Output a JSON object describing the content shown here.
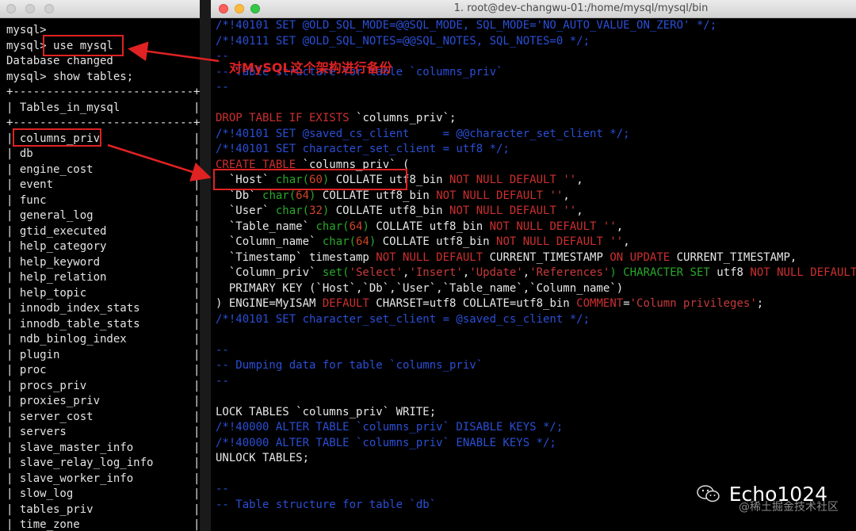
{
  "left_window": {
    "title": "",
    "lines": [
      "mysql>",
      "mysql> use mysql",
      "Database changed",
      "mysql> show tables;",
      "+---------------------------+",
      "| Tables_in_mysql           |",
      "+---------------------------+",
      "| columns_priv              |",
      "| db                        |",
      "| engine_cost               |",
      "| event                     |",
      "| func                      |",
      "| general_log               |",
      "| gtid_executed             |",
      "| help_category             |",
      "| help_keyword              |",
      "| help_relation             |",
      "| help_topic                |",
      "| innodb_index_stats        |",
      "| innodb_table_stats        |",
      "| ndb_binlog_index          |",
      "| plugin                    |",
      "| proc                      |",
      "| procs_priv                |",
      "| proxies_priv              |",
      "| server_cost               |",
      "| servers                   |",
      "| slave_master_info         |",
      "| slave_relay_log_info      |",
      "| slave_worker_info         |",
      "| slow_log                  |",
      "| tables_priv               |",
      "| time_zone                 |"
    ]
  },
  "right_window": {
    "title": "1. root@dev-changwu-01:/home/mysql/mysql/bin",
    "lines": [
      [
        [
          "c",
          "/*!40101 SET @OLD_SQL_MODE=@@SQL_MODE, SQL_MODE='NO_AUTO_VALUE_ON_ZERO' */;"
        ]
      ],
      [
        [
          "c",
          "/*!40111 SET @OLD_SQL_NOTES=@@SQL_NOTES, SQL_NOTES=0 */;"
        ]
      ],
      [
        [
          "c",
          "--"
        ]
      ],
      [
        [
          "c",
          "-- Table structure for table `columns_priv`"
        ]
      ],
      [
        [
          "c",
          "--"
        ]
      ],
      [
        [
          "w",
          ""
        ]
      ],
      [
        [
          "k",
          "DROP TABLE IF EXISTS "
        ],
        [
          "w",
          "`columns_priv`;"
        ]
      ],
      [
        [
          "c",
          "/*!40101 SET @saved_cs_client     = @@character_set_client */;"
        ]
      ],
      [
        [
          "c",
          "/*!40101 SET character_set_client = utf8 */;"
        ]
      ],
      [
        [
          "k",
          "CREATE TABLE "
        ],
        [
          "w",
          "`columns_priv` ("
        ]
      ],
      [
        [
          "w",
          "  `Host` "
        ],
        [
          "g",
          "char("
        ],
        [
          "n",
          "60"
        ],
        [
          "g",
          ")"
        ],
        [
          "w",
          " COLLATE utf8_bin "
        ],
        [
          "k",
          "NOT NULL DEFAULT "
        ],
        [
          "s",
          "''"
        ],
        [
          "w",
          ","
        ]
      ],
      [
        [
          "w",
          "  `Db` "
        ],
        [
          "g",
          "char("
        ],
        [
          "n",
          "64"
        ],
        [
          "g",
          ")"
        ],
        [
          "w",
          " COLLATE utf8_bin "
        ],
        [
          "k",
          "NOT NULL DEFAULT "
        ],
        [
          "s",
          "''"
        ],
        [
          "w",
          ","
        ]
      ],
      [
        [
          "w",
          "  `User` "
        ],
        [
          "g",
          "char("
        ],
        [
          "n",
          "32"
        ],
        [
          "g",
          ")"
        ],
        [
          "w",
          " COLLATE utf8_bin "
        ],
        [
          "k",
          "NOT NULL DEFAULT "
        ],
        [
          "s",
          "''"
        ],
        [
          "w",
          ","
        ]
      ],
      [
        [
          "w",
          "  `Table_name` "
        ],
        [
          "g",
          "char("
        ],
        [
          "n",
          "64"
        ],
        [
          "g",
          ")"
        ],
        [
          "w",
          " COLLATE utf8_bin "
        ],
        [
          "k",
          "NOT NULL DEFAULT "
        ],
        [
          "s",
          "''"
        ],
        [
          "w",
          ","
        ]
      ],
      [
        [
          "w",
          "  `Column_name` "
        ],
        [
          "g",
          "char("
        ],
        [
          "n",
          "64"
        ],
        [
          "g",
          ")"
        ],
        [
          "w",
          " COLLATE utf8_bin "
        ],
        [
          "k",
          "NOT NULL DEFAULT "
        ],
        [
          "s",
          "''"
        ],
        [
          "w",
          ","
        ]
      ],
      [
        [
          "w",
          "  `Timestamp` timestamp "
        ],
        [
          "k",
          "NOT NULL DEFAULT "
        ],
        [
          "w",
          "CURRENT_TIMESTAMP "
        ],
        [
          "k",
          "ON UPDATE "
        ],
        [
          "w",
          "CURRENT_TIMESTAMP,"
        ]
      ],
      [
        [
          "w",
          "  `Column_priv` "
        ],
        [
          "g",
          "set("
        ],
        [
          "s",
          "'Select'"
        ],
        [
          "w",
          ","
        ],
        [
          "s",
          "'Insert'"
        ],
        [
          "w",
          ","
        ],
        [
          "s",
          "'Update'"
        ],
        [
          "w",
          ","
        ],
        [
          "s",
          "'References'"
        ],
        [
          "g",
          ")"
        ],
        [
          "w",
          " "
        ],
        [
          "g",
          "CHARACTER SET "
        ],
        [
          "w",
          "utf8 "
        ],
        [
          "k",
          "NOT NULL DEFAULT "
        ],
        [
          "s",
          "''"
        ],
        [
          "w",
          ","
        ]
      ],
      [
        [
          "w",
          "  PRIMARY KEY (`Host`,`Db`,`User`,`Table_name`,`Column_name`)"
        ]
      ],
      [
        [
          "w",
          ") ENGINE=MyISAM "
        ],
        [
          "k",
          "DEFAULT "
        ],
        [
          "w",
          "CHARSET=utf8 COLLATE=utf8_bin "
        ],
        [
          "k",
          "COMMENT"
        ],
        [
          "w",
          "="
        ],
        [
          "s",
          "'Column privileges'"
        ],
        [
          "w",
          ";"
        ]
      ],
      [
        [
          "c",
          "/*!40101 SET character_set_client = @saved_cs_client */;"
        ]
      ],
      [
        [
          "w",
          ""
        ]
      ],
      [
        [
          "c",
          "--"
        ]
      ],
      [
        [
          "c",
          "-- Dumping data for table `columns_priv`"
        ]
      ],
      [
        [
          "c",
          "--"
        ]
      ],
      [
        [
          "w",
          ""
        ]
      ],
      [
        [
          "w",
          "LOCK TABLES `columns_priv` WRITE;"
        ]
      ],
      [
        [
          "c",
          "/*!40000 ALTER TABLE `columns_priv` DISABLE KEYS */;"
        ]
      ],
      [
        [
          "c",
          "/*!40000 ALTER TABLE `columns_priv` ENABLE KEYS */;"
        ]
      ],
      [
        [
          "w",
          "UNLOCK TABLES;"
        ]
      ],
      [
        [
          "w",
          ""
        ]
      ],
      [
        [
          "c",
          "--"
        ]
      ],
      [
        [
          "c",
          "-- Table structure for table `db`"
        ]
      ]
    ]
  },
  "annotation": {
    "text": "对MySQL这个架构进行备份",
    "color": "#e02222"
  },
  "watermark": {
    "brand": "Echo1024",
    "site": "@稀土掘金技术社区",
    "icon": "wechat-icon"
  }
}
